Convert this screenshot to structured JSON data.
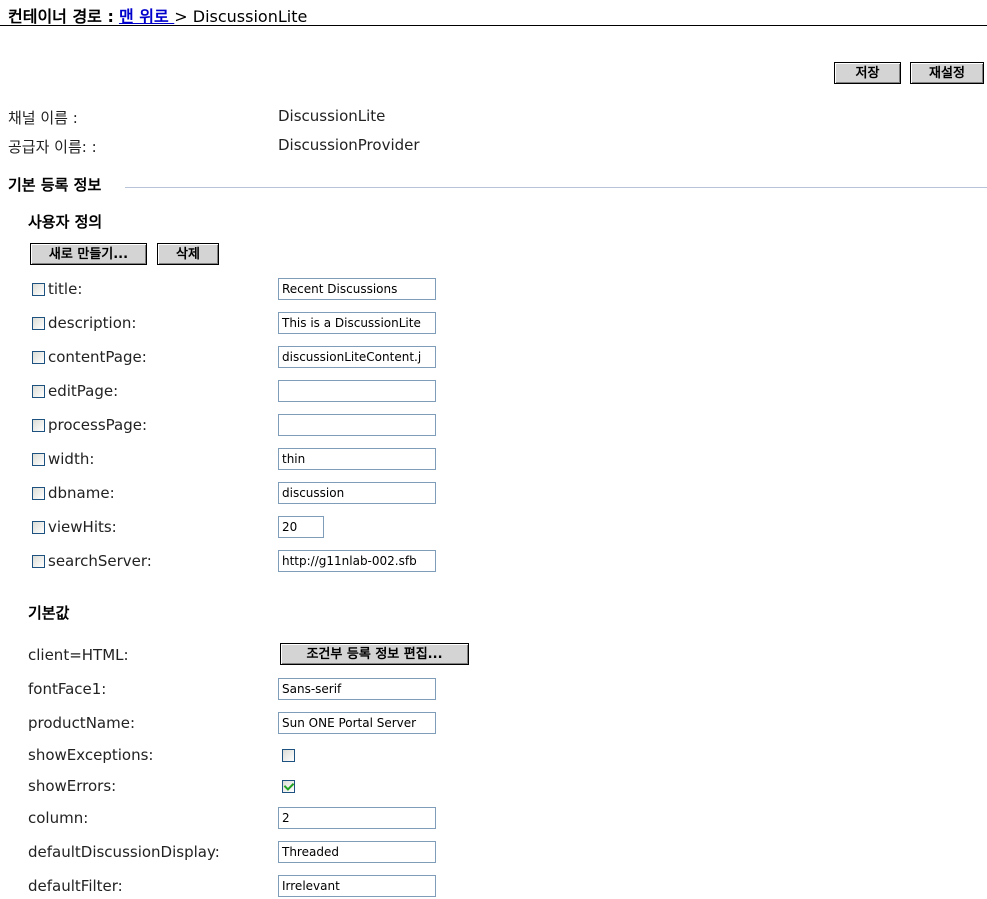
{
  "breadcrumb": {
    "label": "컨테이너 경로 :",
    "top_link": "맨 위로 ",
    "separator": ">",
    "current": "DiscussionLite"
  },
  "toolbar": {
    "save": "저장",
    "reset": "재설정"
  },
  "info": {
    "channel_name_label": "채널 이름 :",
    "channel_name_value": "DiscussionLite",
    "provider_name_label": "공급자 이름: :",
    "provider_name_value": "DiscussionProvider"
  },
  "basic_section": {
    "title": "기본 등록 정보"
  },
  "custom": {
    "title": "사용자 정의",
    "new_button": "새로 만들기...",
    "delete_button": "삭제",
    "rows": [
      {
        "label": "title:",
        "value": "Recent Discussions",
        "checked": false
      },
      {
        "label": "description:",
        "value": "This is a DiscussionLite",
        "checked": false
      },
      {
        "label": "contentPage:",
        "value": "discussionLiteContent.j",
        "checked": false
      },
      {
        "label": "editPage:",
        "value": "",
        "checked": false
      },
      {
        "label": "processPage:",
        "value": "",
        "checked": false
      },
      {
        "label": "width:",
        "value": "thin",
        "checked": false
      },
      {
        "label": "dbname:",
        "value": "discussion",
        "checked": false
      },
      {
        "label": "viewHits:",
        "value": "20",
        "checked": false
      },
      {
        "label": "searchServer:",
        "value": "http://g11nlab-002.sfb",
        "checked": false
      }
    ]
  },
  "defaults": {
    "title": "기본값",
    "client_label": "client=HTML:",
    "conditional_button": "조건부 등록 정보 편집...",
    "fields": [
      {
        "label": "fontFace1:",
        "value": "Sans-serif"
      },
      {
        "label": "productName:",
        "value": "Sun ONE Portal Server"
      }
    ],
    "show_exceptions": {
      "label": "showExceptions:",
      "checked": false
    },
    "show_errors": {
      "label": "showErrors:",
      "checked": true
    },
    "fields2": [
      {
        "label": "column:",
        "value": "2"
      },
      {
        "label": "defaultDiscussionDisplay:",
        "value": "Threaded"
      },
      {
        "label": "defaultFilter:",
        "value": "Irrelevant"
      }
    ]
  }
}
